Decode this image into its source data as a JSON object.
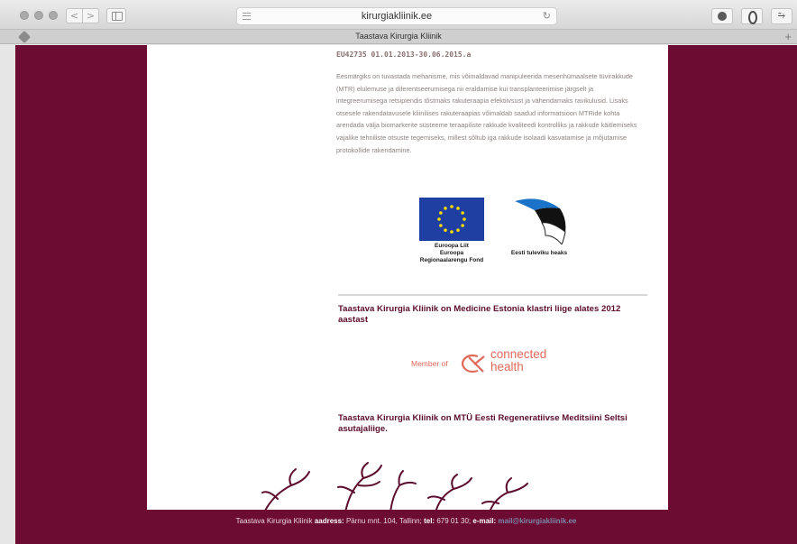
{
  "browser": {
    "url": "kirurgiakliinik.ee",
    "tab_title": "Taastava Kirurgia Kliinik",
    "back_glyph": "<",
    "forward_glyph": ">",
    "reload_glyph": "↻",
    "extension_glyph": "⥲",
    "new_tab_glyph": "+"
  },
  "project": {
    "code": "EU42735 01.01.2013-30.06.2015.a",
    "description": "Eesmärgiks on tuvastada mehanisme, mis võimaldavad manipuleerida mesenhümaalsete tüvirakkude (MTR) elulemuse ja diferentseerumisega nii eraldamise kui transplanteerimise järgselt ja integreerumisega retsipiendis tõstmaks rakuteraapia efektiivsust ja vähendamaks ravikulusid. Lisaks otsesele rakendatavusele kliinilises rakuteraapias võimaldab saadud informatsioon MTRide kohta arendada välja biomarkerite süsteeme teraapiliste rakkude kvaliteedi kontrolliks ja rakkude käitlemiseks vajalike tehniliste otsuste tegemiseks, millest sõltub iga rakkude isolaadi kasvatamise ja mõjutamise protokollide rakendamine."
  },
  "logos": {
    "eu_caption_line1": "Euroopa Liit",
    "eu_caption_line2": "Euroopa",
    "eu_caption_line3": "Regionaalarengu Fond",
    "ee_caption": "Eesti tuleviku heaks"
  },
  "membership": {
    "heading": "Taastava Kirurgia Kliinik on Medicine Estonia klastri liige alates 2012 aastast",
    "member_label": "Member of",
    "logo_line1": "connected",
    "logo_line2": "health",
    "heading2": "Taastava Kirurgia Kliinik on MTÜ Eesti Regeneratiivse Meditsiini Seltsi asutajaliige."
  },
  "footer": {
    "name": "Taastava Kirurgia Kliinik",
    "address_label": "aadress:",
    "address": "Pärnu mnt. 104, Tallinn;",
    "tel_label": "tel:",
    "tel": "679 01 30;",
    "email_label": "e-mail:",
    "email": "mail@kirurgiakliinik.ee"
  },
  "colors": {
    "page_background": "#6d0c33",
    "heading": "#5c0d2f",
    "accent": "#e06a5a",
    "eu_blue": "#1f3fa3",
    "eu_star": "#ffdd00"
  }
}
